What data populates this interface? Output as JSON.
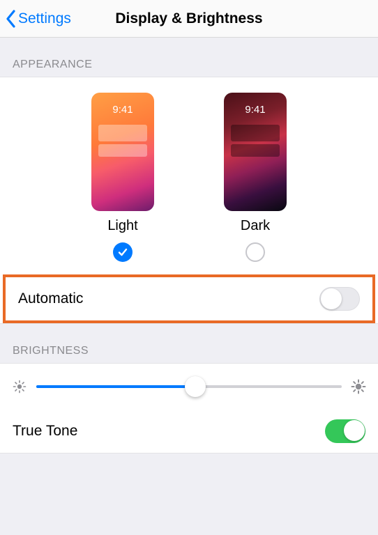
{
  "nav": {
    "back_label": "Settings",
    "title": "Display & Brightness"
  },
  "appearance": {
    "header": "Appearance",
    "preview_time": "9:41",
    "options": [
      {
        "label": "Light",
        "selected": true
      },
      {
        "label": "Dark",
        "selected": false
      }
    ],
    "automatic": {
      "label": "Automatic",
      "on": false,
      "highlighted": true
    }
  },
  "brightness": {
    "header": "Brightness",
    "value_percent": 52,
    "true_tone": {
      "label": "True Tone",
      "on": true
    }
  }
}
